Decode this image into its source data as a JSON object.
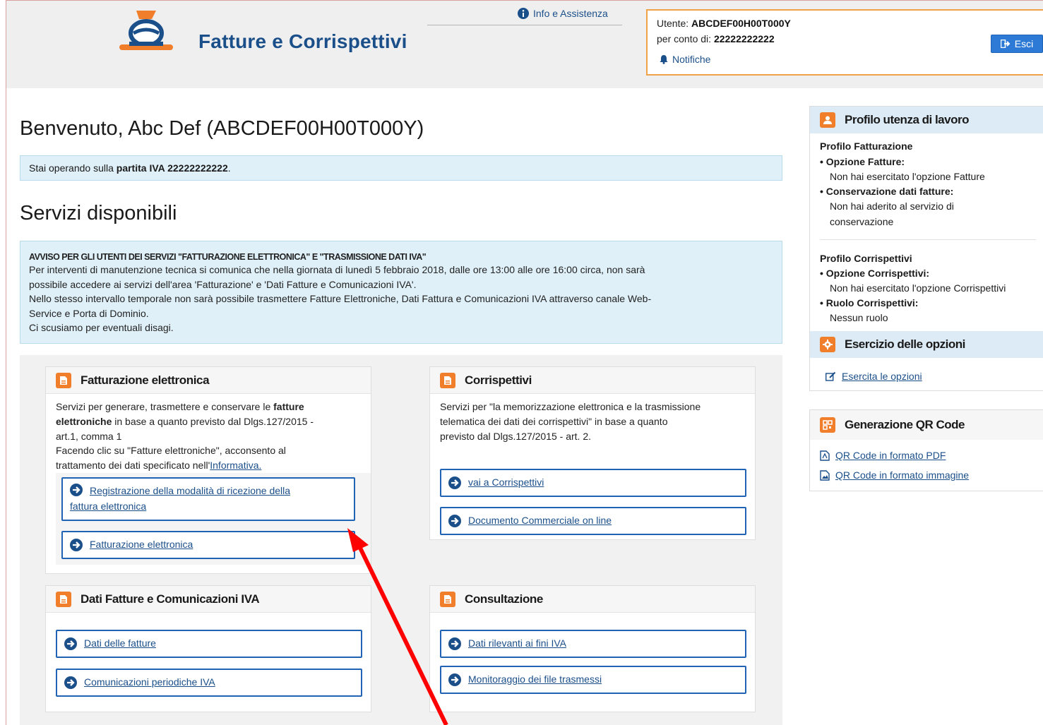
{
  "header": {
    "app_title": "Fatture e Corrispettivi",
    "info_link": "Info e Assistenza",
    "user_label": "Utente:",
    "user_value": "ABCDEF00H00T000Y",
    "account_label": "per conto di:",
    "account_value": "22222222222",
    "notifications": "Notifiche",
    "logout": "Esci"
  },
  "main": {
    "welcome": "Benvenuto, Abc Def (ABCDEF00H00T000Y)",
    "vat_prefix": "Stai operando sulla ",
    "vat_bold": "partita IVA 22222222222",
    "vat_suffix": ".",
    "services_title": "Servizi disponibili",
    "alert": {
      "title": "AVVISO PER GLI UTENTI DEI SERVIZI \"FATTURAZIONE ELETTRONICA\" E \"TRASMISSIONE DATI IVA\"",
      "lines": [
        "Per interventi di manutenzione tecnica si comunica che nella giornata di lunedì 5 febbraio 2018, dalle ore 13:00 alle ore 16:00 circa, non sarà",
        "possibile accedere ai servizi dell'area 'Fatturazione' e 'Dati Fatture e Comunicazioni IVA'.",
        "Nello stesso intervallo temporale non sarà possibile trasmettere Fatture Elettroniche, Dati Fattura e Comunicazioni IVA attraverso canale Web-",
        "Service e Porta di Dominio.",
        "Ci scusiamo per eventuali disagi."
      ]
    }
  },
  "cards": {
    "fatturazione": {
      "title": "Fatturazione elettronica",
      "text_1a": "Servizi per generare, trasmettere e conservare le ",
      "text_1b": "fatture",
      "text_2a": "elettroniche",
      "text_2b": " in base a quanto previsto dal Dlgs.127/2015 -",
      "text_3": "art.1, comma 1",
      "text_4": "Facendo clic su \"Fatture elettroniche\", acconsento al",
      "text_5a": "trattamento dei dati specificato nell'",
      "text_5b": "Informativa.",
      "btn_registrazione_1": "Registrazione della modalità di ricezione della",
      "btn_registrazione_2": "fattura elettronica",
      "btn_fatturazione": "Fatturazione elettronica"
    },
    "corrispettivi": {
      "title": "Corrispettivi",
      "text_1": "Servizi per \"la memorizzazione elettronica e la trasmissione",
      "text_2": "telematica dei dati dei corrispettivi\" in base a quanto",
      "text_3": "previsto dal Dlgs.127/2015 - art. 2.",
      "btn_vai": "vai a Corrispettivi",
      "btn_documento": "Documento Commerciale on line"
    },
    "dati_fatture": {
      "title": "Dati Fatture e Comunicazioni IVA",
      "btn_dati": "Dati delle fatture",
      "btn_comunicazioni": "Comunicazioni periodiche IVA"
    },
    "consultazione": {
      "title": "Consultazione",
      "btn_dati_rilevanti": "Dati rilevanti ai fini IVA",
      "btn_monitoraggio": "Monitoraggio dei file trasmessi"
    }
  },
  "sidebar": {
    "profilo": {
      "title": "Profilo utenza di lavoro",
      "fatturazione_heading": "Profilo Fatturazione",
      "opzione_fatture_label": "Opzione Fatture:",
      "opzione_fatture_value": "Non hai esercitato l'opzione Fatture",
      "conservazione_label": "Conservazione dati fatture:",
      "conservazione_value_1": "Non hai aderito al servizio di",
      "conservazione_value_2": "conservazione",
      "corrispettivi_heading": "Profilo Corrispettivi",
      "opzione_corr_label": "Opzione Corrispettivi:",
      "opzione_corr_value": "Non hai esercitato l'opzione Corrispettivi",
      "ruolo_label": "Ruolo Corrispettivi:",
      "ruolo_value": "Nessun ruolo"
    },
    "esercizio": {
      "title": "Esercizio delle opzioni",
      "link": "Esercita le opzioni"
    },
    "qr": {
      "title": "Generazione QR Code",
      "link_pdf": "QR Code in formato PDF",
      "link_img": "QR Code in formato immagine"
    }
  },
  "colors": {
    "accent_orange": "#f07e2a",
    "link_blue": "#1b4f8a",
    "button_blue": "#2d7ad6",
    "info_bg": "#dff0f8",
    "annotation_red": "#ff0000"
  }
}
